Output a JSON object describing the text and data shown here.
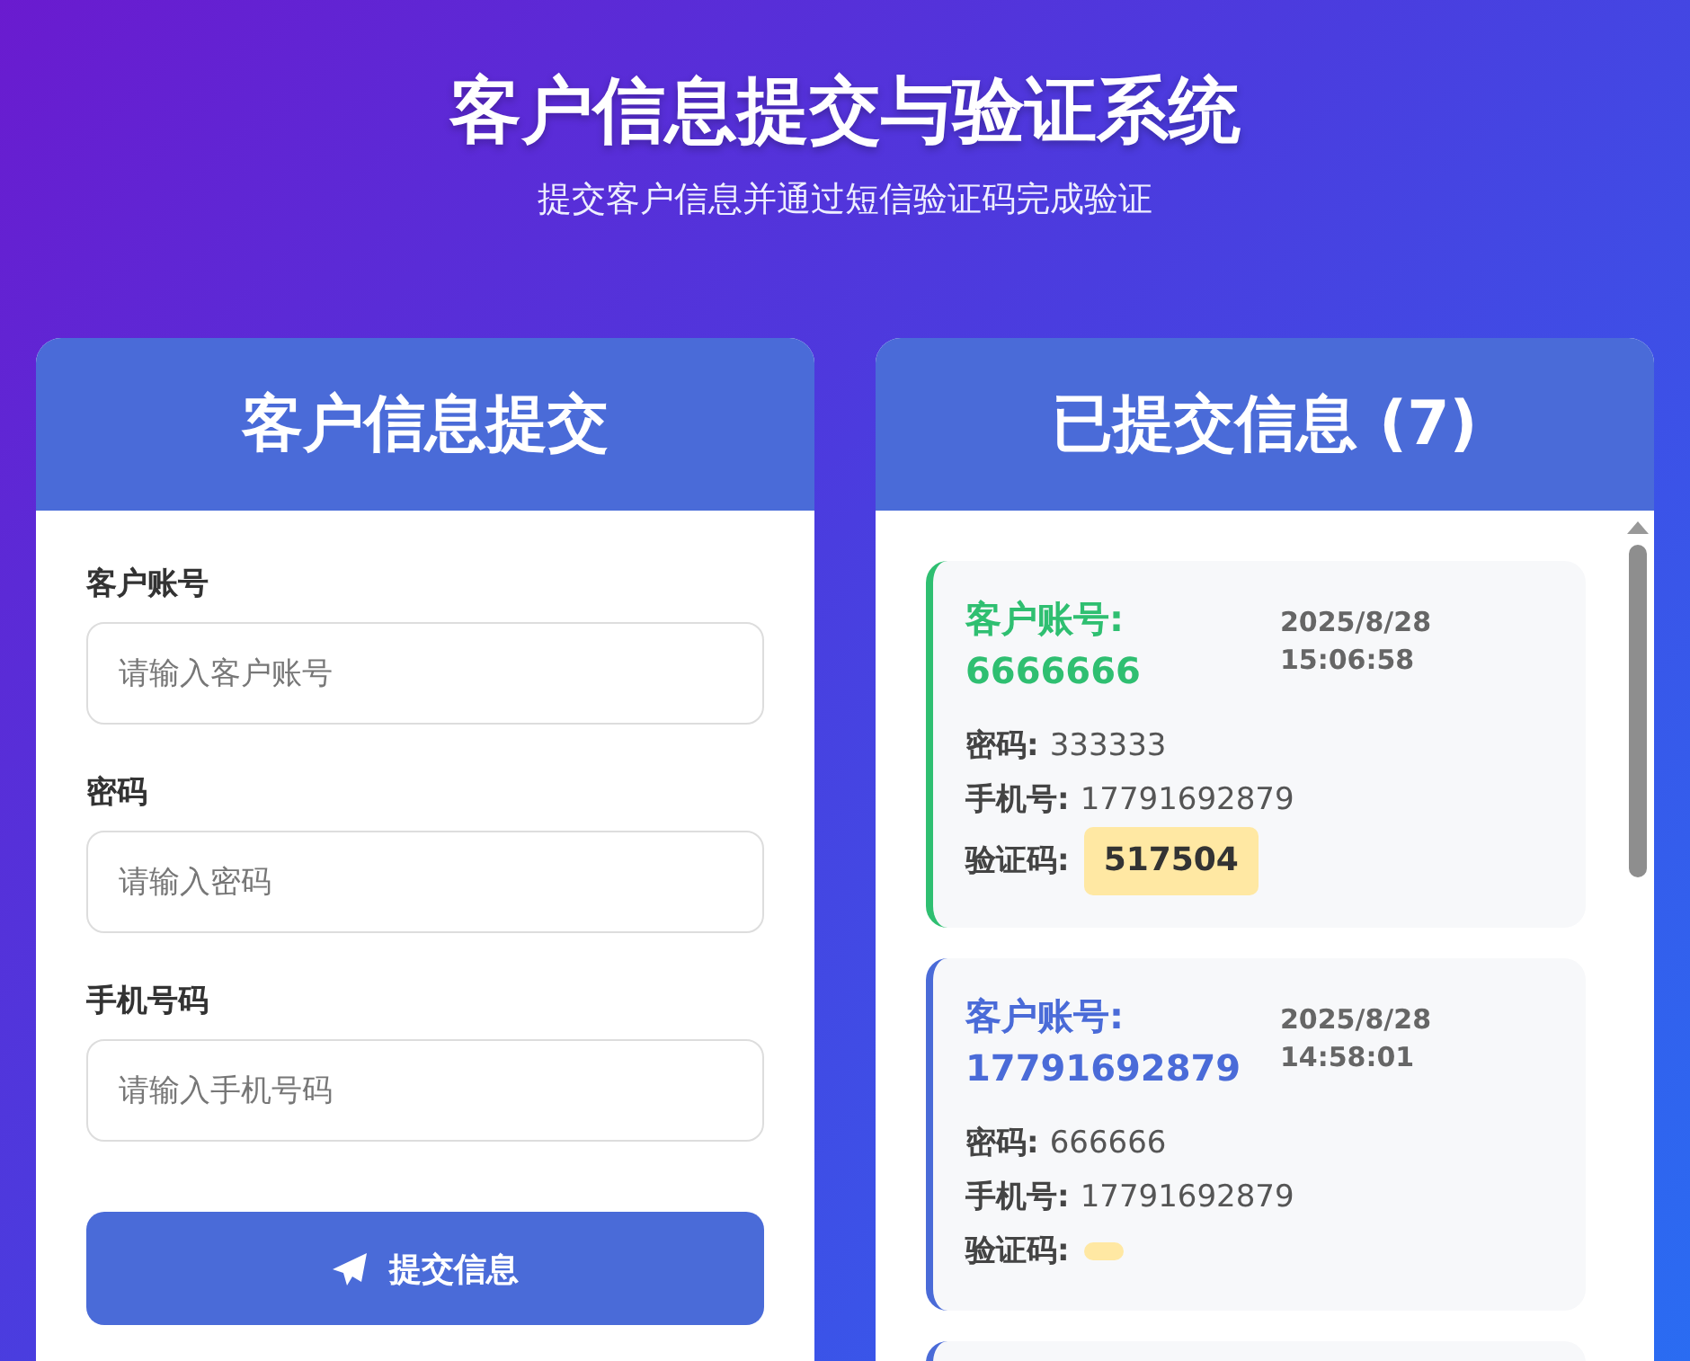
{
  "header": {
    "title": "客户信息提交与验证系统",
    "subtitle": "提交客户信息并通过短信验证码完成验证"
  },
  "form_panel": {
    "title": "客户信息提交",
    "fields": [
      {
        "label": "客户账号",
        "placeholder": "请输入客户账号"
      },
      {
        "label": "密码",
        "placeholder": "请输入密码"
      },
      {
        "label": "手机号码",
        "placeholder": "请输入手机号码"
      }
    ],
    "submit_button": "提交信息"
  },
  "records_panel": {
    "title": "已提交信息 (7)",
    "records": [
      {
        "color": "#2fbf71",
        "account_label": "客户账号:",
        "account": "6666666",
        "time": "2025/8/28 15:06:58",
        "password_label": "密码:",
        "password": "333333",
        "phone_label": "手机号:",
        "phone": "17791692879",
        "code_label": "验证码:",
        "code": "517504"
      },
      {
        "color": "#4a6bd8",
        "account_label": "客户账号:",
        "account": "17791692879",
        "time": "2025/8/28 14:58:01",
        "password_label": "密码:",
        "password": "666666",
        "phone_label": "手机号:",
        "phone": "17791692879",
        "code_label": "验证码:"
      },
      {
        "color": "#4a6bd8"
      }
    ]
  }
}
